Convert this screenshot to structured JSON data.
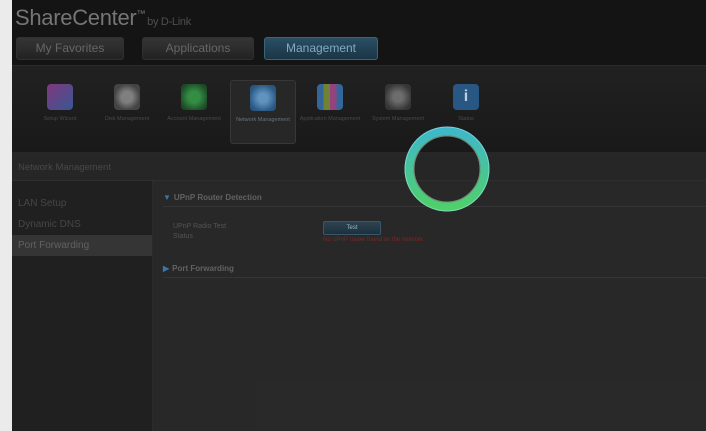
{
  "header": {
    "logo_main": "ShareCenter",
    "logo_tm": "™",
    "logo_sub": "by D-Link"
  },
  "tabs": [
    {
      "label": "My Favorites"
    },
    {
      "label": "Applications"
    },
    {
      "label": "Management"
    }
  ],
  "iconbar": [
    {
      "caption": "Setup Wizard",
      "icon": "wizard-icon",
      "color": "#8a3d8a"
    },
    {
      "caption": "Disk Management",
      "icon": "disk-icon",
      "color": "#a0443a"
    },
    {
      "caption": "Account Management",
      "icon": "account-icon",
      "color": "#2f7a3a"
    },
    {
      "caption": "Network Management",
      "icon": "network-icon",
      "color": "#3a6fa8"
    },
    {
      "caption": "Application Management",
      "icon": "application-icon",
      "color": "#7a8f3a"
    },
    {
      "caption": "System Management",
      "icon": "system-icon",
      "color": "#5a5a5a"
    },
    {
      "caption": "Status",
      "icon": "status-icon",
      "color": "#2d5f8f"
    }
  ],
  "section": {
    "title": "Network Management"
  },
  "sidebar": {
    "items": [
      {
        "label": "LAN Setup"
      },
      {
        "label": "Dynamic DNS"
      },
      {
        "label": "Port Forwarding"
      }
    ]
  },
  "main": {
    "upnp_title": "UPnP Router Detection",
    "upnp_radio_label": "UPnP Radio Test",
    "status_label": "Status",
    "test_button": "Test",
    "status_text": "No UPnP router found on the network",
    "pf_title": "Port Forwarding"
  },
  "colors": {
    "accent": "#3f7fb5",
    "spinner_outer": "#3fb8c8",
    "spinner_inner": "#4fd06a"
  }
}
